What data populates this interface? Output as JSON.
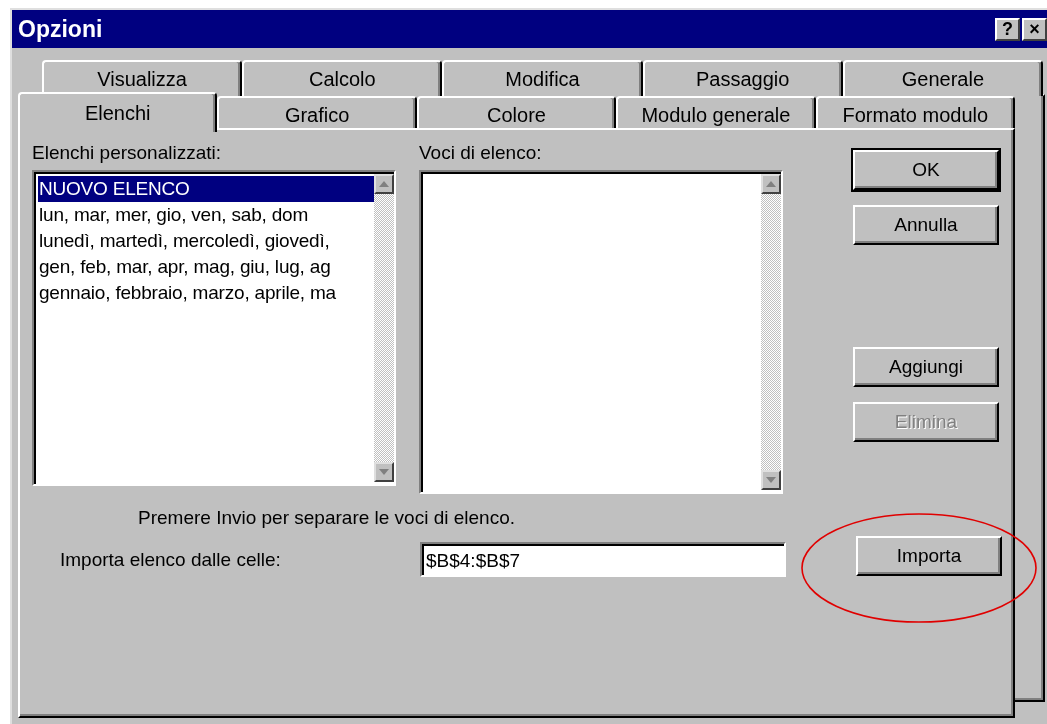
{
  "window": {
    "title": "Opzioni",
    "title_buttons": [
      "?",
      "×"
    ]
  },
  "tab_rows": [
    {
      "tabs": [
        {
          "label": "Visualizza",
          "selected": false
        },
        {
          "label": "Calcolo",
          "selected": false
        },
        {
          "label": "Modifica",
          "selected": false
        },
        {
          "label": "Passaggio",
          "selected": false
        },
        {
          "label": "Generale",
          "selected": false
        }
      ]
    },
    {
      "tabs": [
        {
          "label": "Elenchi",
          "selected": true
        },
        {
          "label": "Grafico",
          "selected": false
        },
        {
          "label": "Colore",
          "selected": false
        },
        {
          "label": "Modulo generale",
          "selected": false
        },
        {
          "label": "Formato modulo",
          "selected": false
        }
      ]
    }
  ],
  "custom_lists": {
    "label": "Elenchi personalizzati:",
    "items": [
      {
        "text": "NUOVO ELENCO",
        "selected": true
      },
      {
        "text": "lun, mar, mer, gio, ven, sab, dom",
        "selected": false
      },
      {
        "text": "lunedì, martedì, mercoledì, giovedì,",
        "selected": false
      },
      {
        "text": "gen, feb, mar, apr, mag, giu, lug, ag",
        "selected": false
      },
      {
        "text": "gennaio, febbraio, marzo, aprile, ma",
        "selected": false
      }
    ]
  },
  "list_entries": {
    "label": "Voci di elenco:"
  },
  "dialog_buttons": [
    {
      "label": "OK",
      "default": true,
      "disabled": false
    },
    {
      "label": "Annulla",
      "default": false,
      "disabled": false
    }
  ],
  "list_buttons": [
    {
      "label": "Aggiungi",
      "default": false,
      "disabled": false
    },
    {
      "label": "Elimina",
      "default": false,
      "disabled": true
    }
  ],
  "import": {
    "hint": "Premere Invio per separare le voci di elenco.",
    "label": "Importa elenco dalle celle:",
    "value": "$B$4:$B$7",
    "button": {
      "label": "Importa",
      "default": false,
      "disabled": false
    }
  },
  "annotation": {
    "kind": "ellipse"
  }
}
